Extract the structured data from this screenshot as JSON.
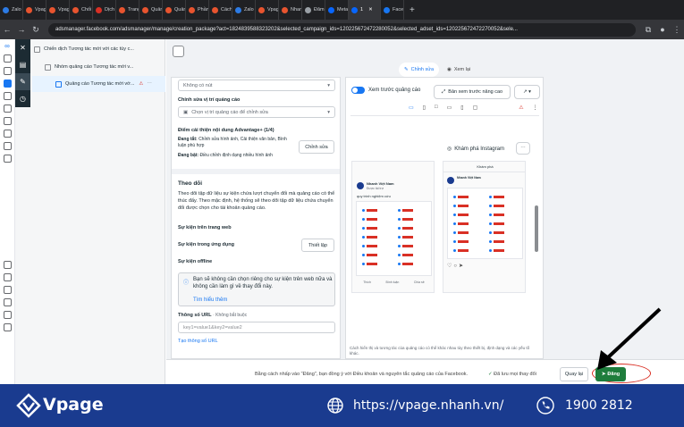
{
  "browser": {
    "tabs": [
      "Zalo",
      "Vpag",
      "Vpag",
      "Chối",
      "Dịch",
      "Trang",
      "Quản",
      "Quản",
      "Phần",
      "Cách",
      "Zalo",
      "Vpag",
      "Nhan",
      "Đăm",
      "Meta",
      "1",
      "Facel"
    ],
    "active_tab": "1",
    "url": "adsmanager.facebook.com/adsmanager/manage/creation_package?act=1824839588323202&selected_campaign_ids=120225672472280052&selected_adset_ids=120225672472270052&sele..."
  },
  "tree": {
    "campaign": "Chiến dịch Tương tác mới với các tùy c...",
    "adset": "Nhóm quảng cáo Tương tác mới v...",
    "ad": "Quảng cáo Tương tác mới vớ..."
  },
  "header": {
    "edit_tab": "Chỉnh sửa",
    "review_tab": "Xem lại"
  },
  "form": {
    "cta_value": "Không có nút",
    "placement_label": "Chỉnh sửa vị trí quảng cáo",
    "placement_value": "Chọn vị trí quảng cáo để chỉnh sửa",
    "advantage_title": "Điểm cải thiện nội dung Advantage+ (1/4)",
    "advantage_on_label": "Đang tắt:",
    "advantage_on_text": "Chỉnh sửa hình ảnh, Cải thiện văn bản, Bình luận phù hợp",
    "advantage_on2_label": "Đang bật:",
    "advantage_on2_text": "Điều chỉnh định dạng nhiều hình ảnh",
    "advantage_edit": "Chỉnh sửa",
    "tracking_title": "Theo dõi",
    "tracking_desc": "Theo dõi tập dữ liệu sự kiện chứa lượt chuyển đổi mà quảng cáo có thể thúc đẩy. Theo mặc định, hệ thống sẽ theo dõi tập dữ liệu chứa chuyển đổi được chọn cho tài khoản quảng cáo.",
    "web_events": "Sự kiện trên trang web",
    "app_events": "Sự kiện trong ứng dụng",
    "setup_button": "Thiết lập",
    "offline_events": "Sự kiện offline",
    "info_text": "Bạn sẽ không cần chọn riêng cho sự kiện trên web nữa và không cần làm gì về thay đổi này.",
    "info_link": "Tìm hiểu thêm",
    "url_params_label": "Thông số URL",
    "url_params_optional": "· Không bắt buộc",
    "url_params_placeholder": "key1=value1&key2=value2",
    "create_url_params": "Tạo thông số URL"
  },
  "preview": {
    "toggle_label": "Xem trước quảng cáo",
    "advanced_preview": "Bản xem trước nâng cao",
    "explore_instagram": "Khám phá Instagram",
    "page_name": "Nhanh Việt Nam",
    "sponsored": "Được tài trợ",
    "post_title": "quy trình nghiệm cứu",
    "explore_header": "Khám phá",
    "like": "Thích",
    "comment": "Bình luận",
    "share": "Chia sẻ",
    "disclaimer": "Cách hiển thị và tương tác của quảng cáo có thể khác nhau tùy theo thiết bị, định dạng và các yếu tố khác."
  },
  "footer": {
    "terms_text": "Bằng cách nhấp vào \"Đăng\", bạn đồng ý với Điều khoản và nguyên tắc quảng cáo của Facebook.",
    "saved_status": "Đã lưu mọi thay đổi",
    "back_button": "Quay lại",
    "publish_button": "Đăng"
  },
  "banner": {
    "brand": "Vpage",
    "website": "https://vpage.nhanh.vn/",
    "phone": "1900 2812",
    "bg_color": "#1a3b8f"
  },
  "colors": {
    "publish_green": "#1e7d3c",
    "highlight_red": "#d93025",
    "accent_blue": "#1877f2"
  }
}
